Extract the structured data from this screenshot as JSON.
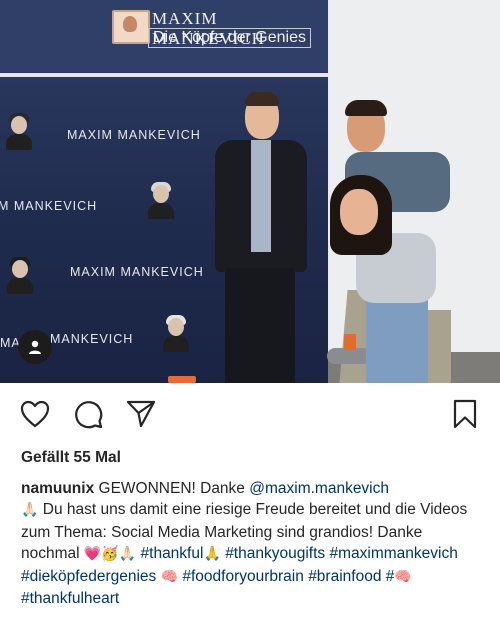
{
  "photo": {
    "brand_title": "MAXIM MANKEVICH",
    "brand_subtitle": "Die Köpfe der Genies",
    "wall_texts": [
      "MAXIM MANKEVICH",
      "M MANKEVICH",
      "MAXIM MANKEVICH",
      "MA",
      "MANKEVICH"
    ],
    "user_tag_icon": "person-icon"
  },
  "actions": {
    "like_icon": "heart-outline-icon",
    "comment_icon": "comment-bubble-icon",
    "share_icon": "paper-plane-icon",
    "save_icon": "bookmark-outline-icon"
  },
  "likes_text": "Gefällt 55 Mal",
  "caption": {
    "username": "namuunix",
    "text_1": " GEWONNEN! Danke ",
    "mention": "@maxim.mankevich",
    "emoji_1": "🙏🏻",
    "text_2": " Du hast uns damit eine riesige Freude bereitet und die Videos zum Thema: Social Media Marketing sind grandios! Danke nochmal ",
    "emoji_2": "💗🥳🙏🏻",
    "hashtag_1": "#thankful",
    "emoji_3": "🙏",
    "hashtag_2": "#thankyougifts",
    "hashtag_3": "#maximmankevich",
    "hashtag_4": "#dieköpfedergenies",
    "emoji_4": "🧠",
    "hashtag_5": "#foodforyourbrain",
    "hashtag_6": "#brainfood",
    "hashtag_7": "#",
    "emoji_5": "🧠",
    "hashtag_8": "#thankfulheart"
  },
  "colors": {
    "text": "#262626",
    "link": "#003569",
    "banner": "#263459"
  }
}
